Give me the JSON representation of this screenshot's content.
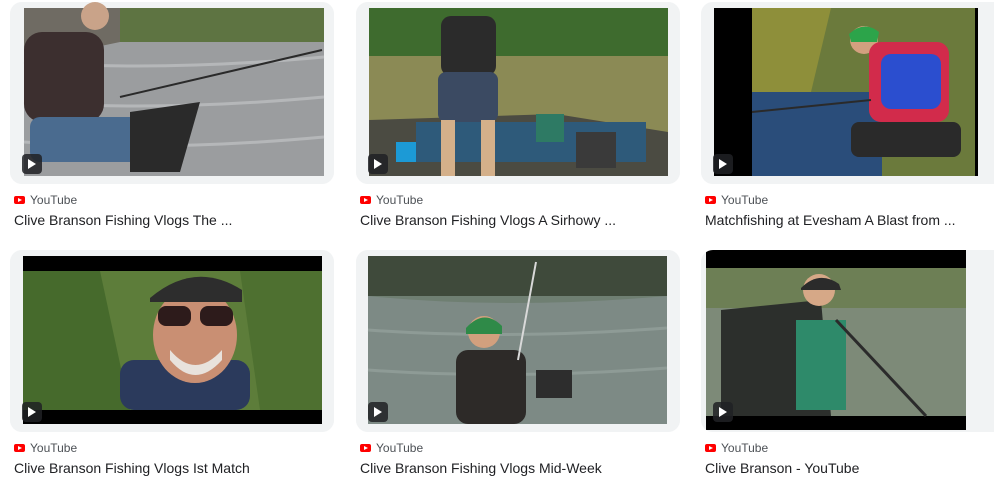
{
  "results": [
    {
      "source": "YouTube",
      "title": "Clive Branson Fishing Vlogs The ...",
      "thumb_icon": "video-thumbnail-angler-lake"
    },
    {
      "source": "YouTube",
      "title": "Clive Branson Fishing Vlogs A Sirhowy ...",
      "thumb_icon": "video-thumbnail-angler-platform"
    },
    {
      "source": "YouTube",
      "title": "Matchfishing at Evesham A Blast from ...",
      "thumb_icon": "video-thumbnail-angler-reeds"
    },
    {
      "source": "YouTube",
      "title": "Clive Branson Fishing Vlogs Ist Match",
      "thumb_icon": "video-thumbnail-selfie"
    },
    {
      "source": "YouTube",
      "title": "Clive Branson Fishing Vlogs Mid-Week",
      "thumb_icon": "video-thumbnail-angler-back"
    },
    {
      "source": "YouTube",
      "title": "Clive Branson - YouTube",
      "thumb_icon": "video-thumbnail-angler-river"
    }
  ],
  "colors": {
    "youtube_red": "#ff0000",
    "title_text": "#202124",
    "source_text": "#4d5156"
  }
}
